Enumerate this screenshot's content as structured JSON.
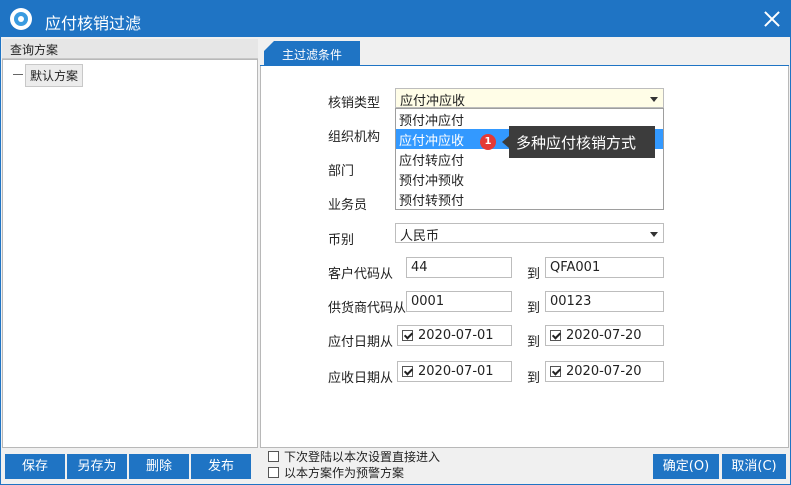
{
  "window": {
    "title": "应付核销过滤"
  },
  "left": {
    "header": "查询方案",
    "tree_item": "默认方案"
  },
  "tab": {
    "label": "主过滤条件"
  },
  "form": {
    "writeoff_type_label": "核销类型",
    "writeoff_type_value": "应付冲应收",
    "writeoff_options": [
      "预付冲应付",
      "应付冲应收",
      "应付转应付",
      "预付冲预收",
      "预付转预付"
    ],
    "org_label": "组织机构",
    "dept_label": "部门",
    "salesman_label": "业务员",
    "currency_label": "币别",
    "currency_value": "人民币",
    "customer_code_label": "客户代码从",
    "customer_code_from": "44",
    "to_label": "到",
    "customer_code_to": "QFA001",
    "supplier_code_label": "供货商代码从",
    "supplier_code_from": "0001",
    "supplier_code_to": "00123",
    "payable_date_label": "应付日期从",
    "payable_date_from": "2020-07-01",
    "payable_date_to": "2020-07-20",
    "receivable_date_label": "应收日期从",
    "receivable_date_from": "2020-07-01",
    "receivable_date_to": "2020-07-20"
  },
  "annotation": {
    "badge": "1",
    "tooltip": "多种应付核销方式"
  },
  "footer": {
    "save": "保存",
    "save_as": "另存为",
    "delete": "删除",
    "publish": "发布",
    "option1": "下次登陆以本次设置直接进入",
    "option2": "以本方案作为预警方案",
    "ok": "确定(O)",
    "cancel": "取消(C)"
  },
  "colors": {
    "accent": "#1f74c4",
    "selection": "#3399ff",
    "badge": "#e53935"
  }
}
